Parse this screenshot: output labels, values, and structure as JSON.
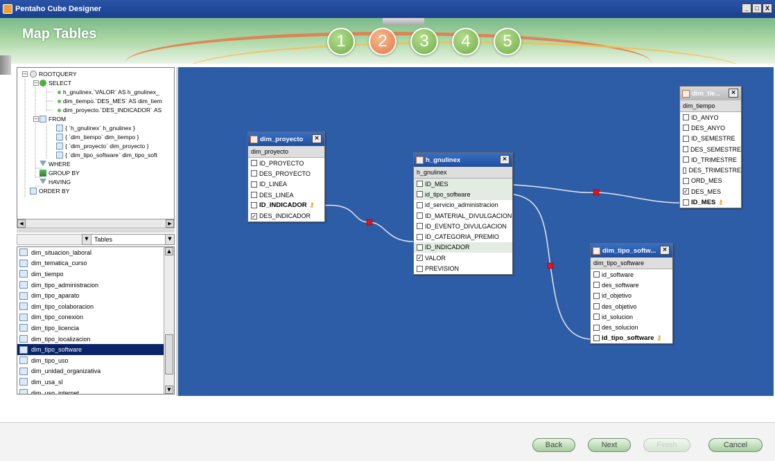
{
  "window": {
    "title": "Pentaho Cube Designer",
    "controls": [
      "_",
      "□",
      "X"
    ]
  },
  "header": {
    "page_title": "Map Tables",
    "steps": [
      {
        "label": "1",
        "state": "done"
      },
      {
        "label": "2",
        "state": "active"
      },
      {
        "label": "3",
        "state": "done"
      },
      {
        "label": "4",
        "state": "done"
      },
      {
        "label": "5",
        "state": "done"
      }
    ]
  },
  "query_tree": {
    "nodes": [
      {
        "text": "ROOTQUERY",
        "depth": 0,
        "icon": "root-icon"
      },
      {
        "text": "SELECT",
        "depth": 1,
        "icon": "select-check-icon"
      },
      {
        "text": "h_gnulinex.`VALOR` AS h_gnulinex_",
        "depth": 2,
        "icon": "field-dot-icon"
      },
      {
        "text": "dim_tiempo.`DES_MES` AS dim_tiem",
        "depth": 2,
        "icon": "field-dot-icon"
      },
      {
        "text": "dim_proyecto.`DES_INDICADOR` AS",
        "depth": 2,
        "icon": "field-dot-icon"
      },
      {
        "text": "FROM",
        "depth": 1,
        "icon": "from-table-icon"
      },
      {
        "text": "{ `h_gnulinex` h_gnulinex }",
        "depth": 2,
        "icon": "table-icon"
      },
      {
        "text": "{ `dim_tiempo` dim_tiempo }",
        "depth": 2,
        "icon": "table-icon"
      },
      {
        "text": "{ `dim_proyecto` dim_proyecto }",
        "depth": 2,
        "icon": "table-icon"
      },
      {
        "text": "{ `dim_tipo_software` dim_tipo_soft",
        "depth": 2,
        "icon": "table-icon"
      },
      {
        "text": "WHERE",
        "depth": 1,
        "icon": "filter-icon"
      },
      {
        "text": "GROUP BY",
        "depth": 1,
        "icon": "group-icon"
      },
      {
        "text": "HAVING",
        "depth": 1,
        "icon": "filter-icon"
      },
      {
        "text": "ORDER BY",
        "depth": 0,
        "icon": "order-icon"
      }
    ]
  },
  "table_type_combo": {
    "selected": "Tables"
  },
  "table_list": {
    "items": [
      "dim_situacion_laboral",
      "dim_tematica_curso",
      "dim_tiempo",
      "dim_tipo_administracion",
      "dim_tipo_aparato",
      "dim_tipo_colaboracion",
      "dim_tipo_conexion",
      "dim_tipo_licencia",
      "dim_tipo_localizacion",
      "dim_tipo_software",
      "dim_tipo_uso",
      "dim_unidad_organizativa",
      "dim_usa_sl",
      "dim_uso_internet"
    ],
    "selected": "dim_tipo_software"
  },
  "diagram": {
    "tables": [
      {
        "id": "dim_proyecto",
        "title": "dim_proyecto",
        "subtitle": "dim_proyecto",
        "columns": [
          {
            "name": "ID_PROYECTO",
            "checked": false
          },
          {
            "name": "DES_PROYECTO",
            "checked": false
          },
          {
            "name": "ID_LINEA",
            "checked": false
          },
          {
            "name": "DES_LINEA",
            "checked": false
          },
          {
            "name": "ID_INDICADOR",
            "checked": false,
            "key": true
          },
          {
            "name": "DES_INDICADOR",
            "checked": true
          }
        ]
      },
      {
        "id": "h_gnulinex",
        "title": "h_gnulinex",
        "subtitle": "h_gnulinex",
        "columns": [
          {
            "name": "ID_MES",
            "checked": false,
            "highlight": true
          },
          {
            "name": "id_tipo_software",
            "checked": false,
            "highlight": true
          },
          {
            "name": "id_servicio_administracion",
            "checked": false
          },
          {
            "name": "ID_MATERIAL_DIVULGACION",
            "checked": false
          },
          {
            "name": "ID_EVENTO_DIVULGACION",
            "checked": false
          },
          {
            "name": "ID_CATEGORIA_PREMIO",
            "checked": false
          },
          {
            "name": "ID_INDICADOR",
            "checked": false,
            "highlight": true
          },
          {
            "name": "VALOR",
            "checked": true
          },
          {
            "name": "PREVISION",
            "checked": false
          }
        ]
      },
      {
        "id": "dim_tiempo",
        "title": "dim_tie...",
        "subtitle": "dim_tiempo",
        "columns": [
          {
            "name": "ID_ANYO",
            "checked": false
          },
          {
            "name": "DES_ANYO",
            "checked": false
          },
          {
            "name": "ID_SEMESTRE",
            "checked": false
          },
          {
            "name": "DES_SEMESTRE",
            "checked": false
          },
          {
            "name": "ID_TRIMESTRE",
            "checked": false
          },
          {
            "name": "DES_TRIMESTRE",
            "checked": false
          },
          {
            "name": "ORD_MES",
            "checked": false
          },
          {
            "name": "DES_MES",
            "checked": true
          },
          {
            "name": "ID_MES",
            "checked": false,
            "key": true
          }
        ]
      },
      {
        "id": "dim_tipo_software",
        "title": "dim_tipo_softw...",
        "subtitle": "dim_tipo_software",
        "columns": [
          {
            "name": "id_software",
            "checked": false
          },
          {
            "name": "des_software",
            "checked": false
          },
          {
            "name": "id_objetivo",
            "checked": false
          },
          {
            "name": "des_objetivo",
            "checked": false
          },
          {
            "name": "id_solucion",
            "checked": false
          },
          {
            "name": "des_solucion",
            "checked": false
          },
          {
            "name": "id_tipo_software",
            "checked": false,
            "key": true
          }
        ]
      }
    ]
  },
  "footer": {
    "back_label": "Back",
    "next_label": "Next",
    "finish_label": "Finish",
    "cancel_label": "Cancel"
  },
  "colors": {
    "canvas_bg": "#2e5da8",
    "selected_row": "#0a246a",
    "join_marker": "#e0141e",
    "step_done": "#6fae49",
    "step_active": "#e07a46"
  }
}
